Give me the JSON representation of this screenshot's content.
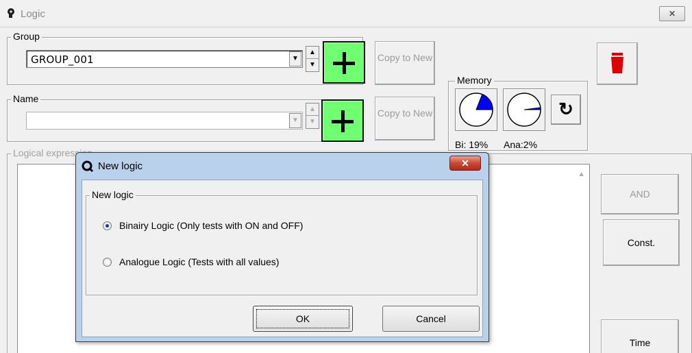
{
  "window": {
    "title": "Logic",
    "close_glyph": "✕"
  },
  "group": {
    "legend": "Group",
    "value": "GROUP_001"
  },
  "name": {
    "legend": "Name",
    "value": ""
  },
  "copy_to_new_1": "Copy to New",
  "copy_to_new_2": "Copy to New",
  "memory": {
    "legend": "Memory",
    "bi_label": "Bi: 19%",
    "ana_label": "Ana:2%",
    "bi_fraction": 0.19,
    "ana_fraction": 0.02,
    "fill_color": "#0000ff"
  },
  "logical_expression": {
    "legend": "Logical expression"
  },
  "buttons": {
    "and": "AND",
    "const": "Const.",
    "time": "Time"
  },
  "dialog": {
    "title": "New logic",
    "group_legend": "New logic",
    "options": [
      {
        "label": "Binairy Logic (Only tests with ON and OFF)",
        "checked": true
      },
      {
        "label": "Analogue Logic (Tests with all values)",
        "checked": false
      }
    ],
    "ok": "OK",
    "cancel": "Cancel"
  },
  "colors": {
    "add_button": "#70ff70",
    "delete_icon": "#e00000"
  }
}
